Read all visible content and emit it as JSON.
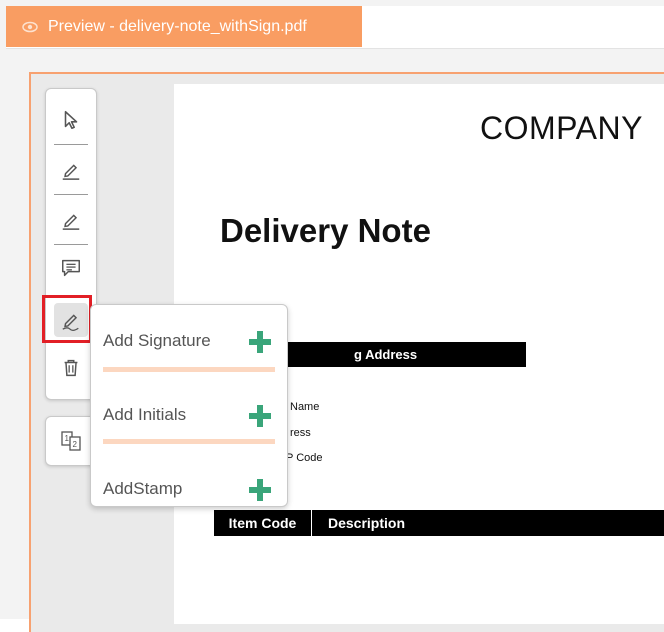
{
  "tab": {
    "title": "Preview - delivery-note_withSign.pdf",
    "icon": "eye-icon"
  },
  "toolbar": {
    "tools": [
      {
        "name": "select-tool",
        "icon": "cursor-icon"
      },
      {
        "name": "pen-tool",
        "icon": "pen-icon"
      },
      {
        "name": "highlight-tool",
        "icon": "pen-icon"
      },
      {
        "name": "comment-tool",
        "icon": "comment-icon"
      },
      {
        "name": "signature-tool",
        "icon": "signature-icon",
        "active": true
      },
      {
        "name": "delete-tool",
        "icon": "trash-icon"
      }
    ],
    "pages_icon": "page-order-icon"
  },
  "signature_menu": {
    "items": [
      {
        "label": "Add Signature"
      },
      {
        "label": "Add Initials"
      },
      {
        "label": "AddStamp"
      }
    ],
    "plus_color": "#3aa57a",
    "separator_color": "#fcd7c0"
  },
  "document": {
    "company": "COMPANY",
    "title": "Delivery Note",
    "address_bar": "g Address",
    "fields": [
      "Name",
      "ress",
      "P Code"
    ],
    "table_headers": [
      "Item Code",
      "Description"
    ]
  },
  "colors": {
    "tab": "#f99d62",
    "viewer_border": "#f7a170",
    "highlight": "#e21f26"
  }
}
